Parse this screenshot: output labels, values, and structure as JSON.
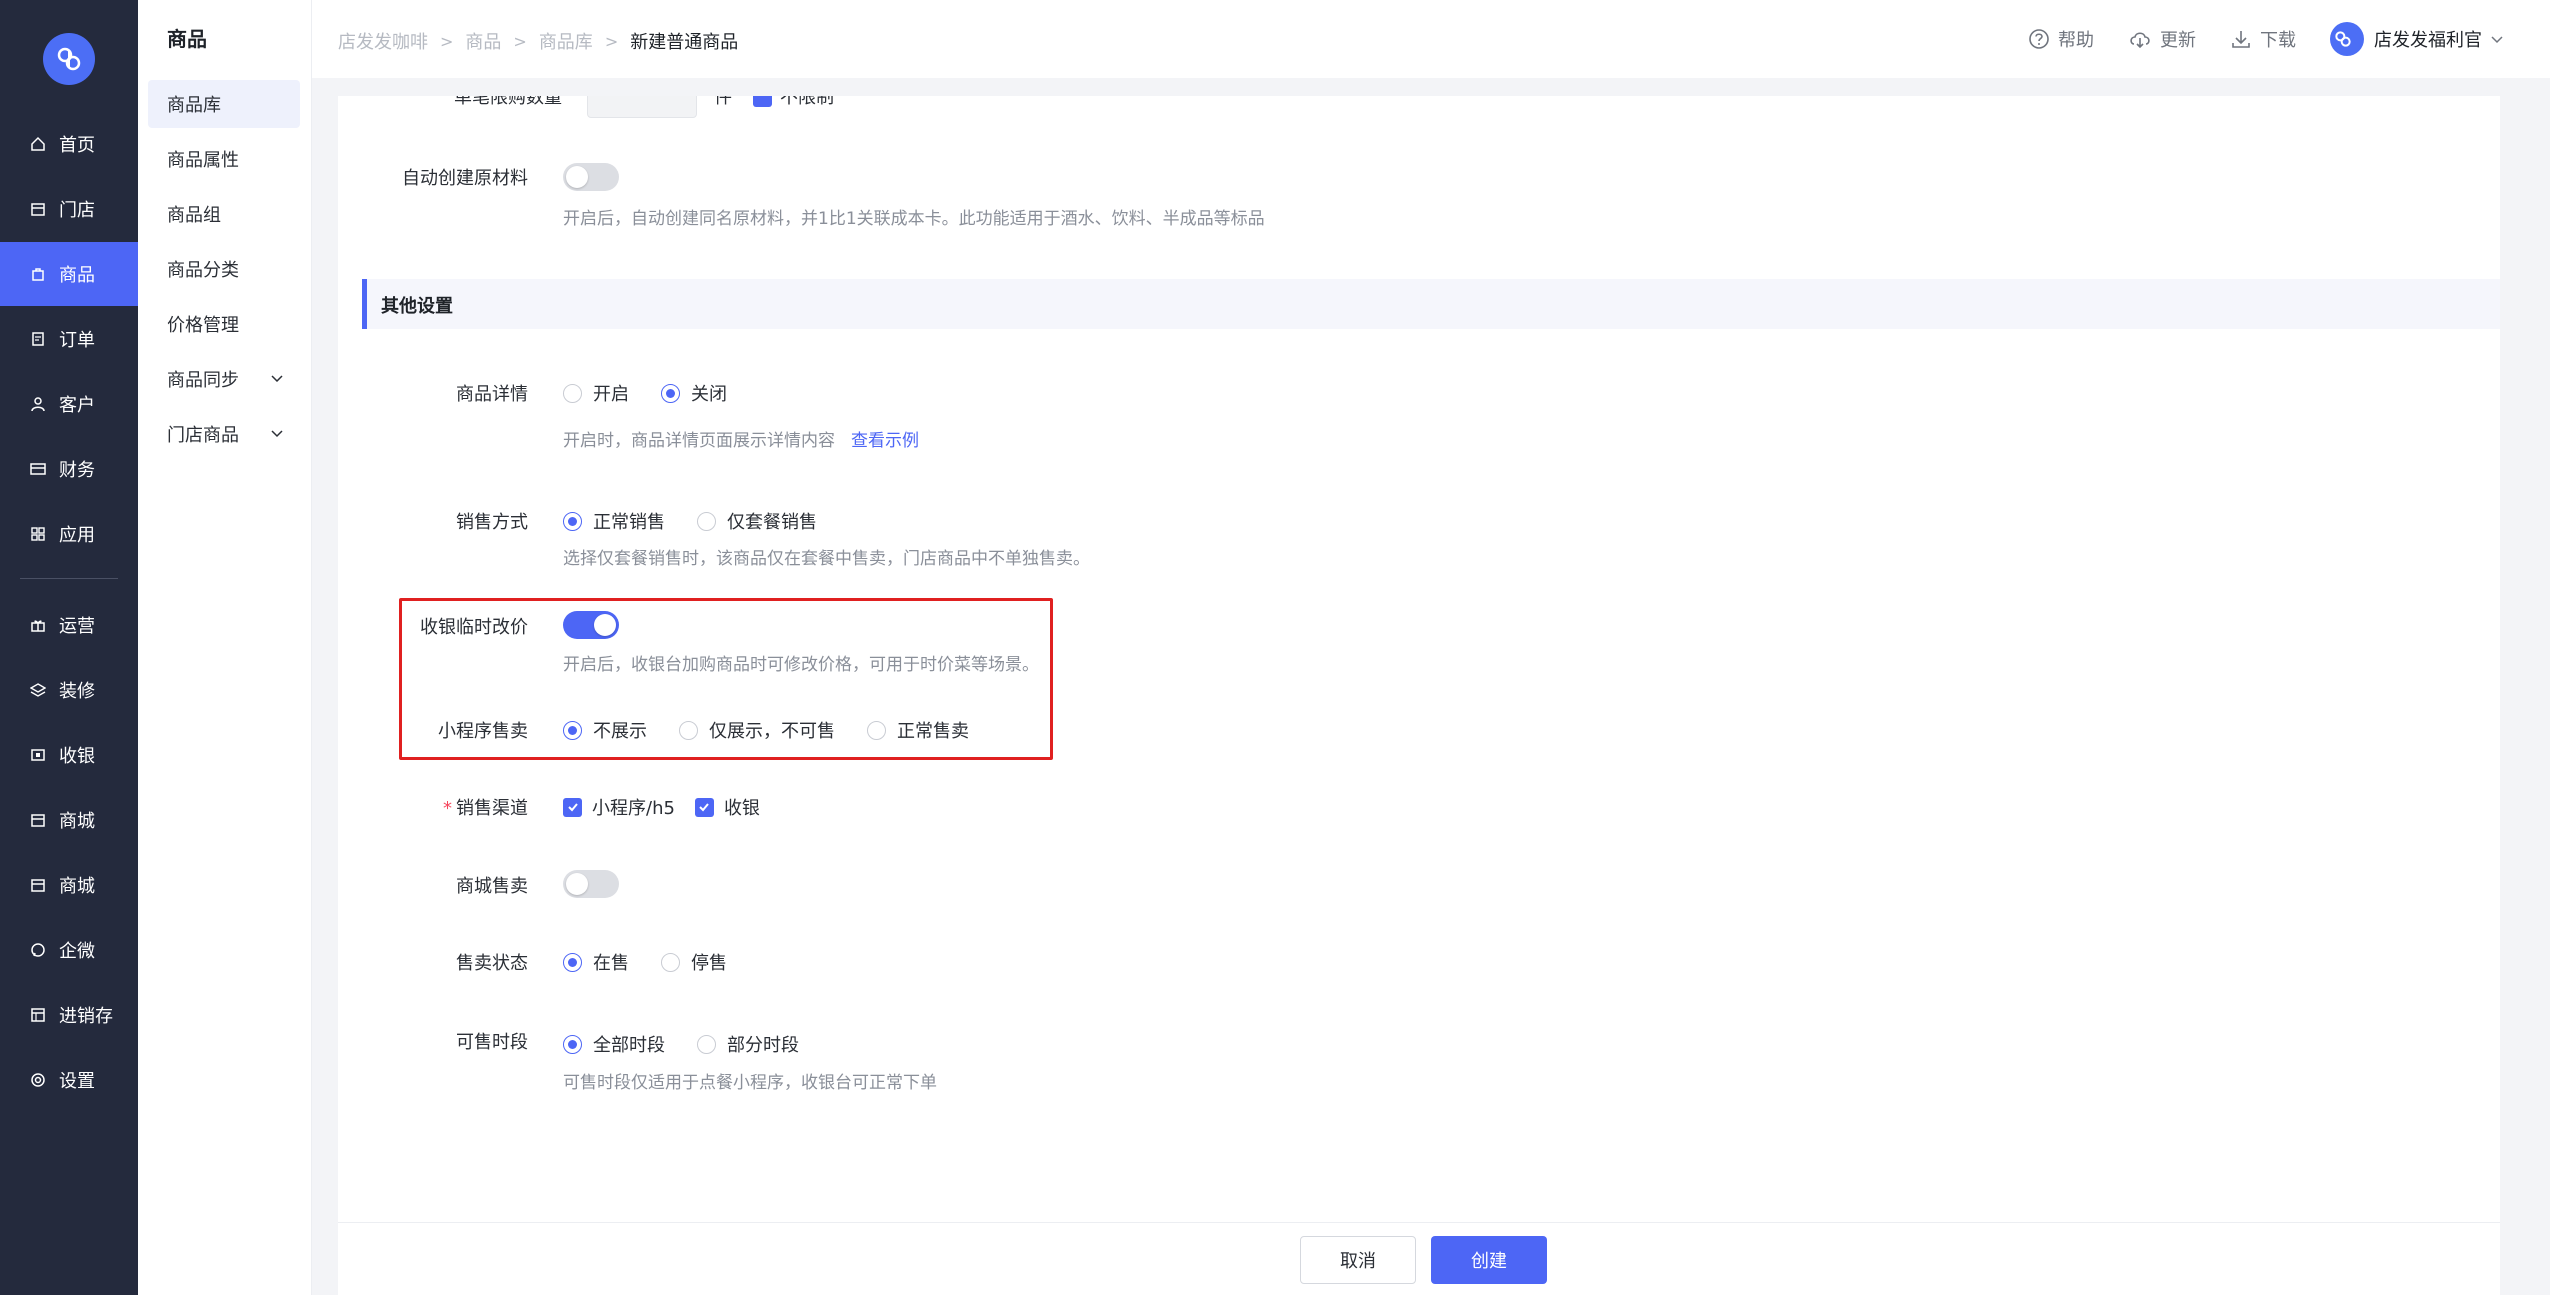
{
  "nav": {
    "items": [
      {
        "label": "首页",
        "icon": "home-icon"
      },
      {
        "label": "门店",
        "icon": "store-icon"
      },
      {
        "label": "商品",
        "icon": "bag-icon",
        "active": true
      },
      {
        "label": "订单",
        "icon": "order-icon"
      },
      {
        "label": "客户",
        "icon": "user-icon"
      },
      {
        "label": "财务",
        "icon": "card-icon"
      },
      {
        "label": "应用",
        "icon": "apps-icon"
      },
      {
        "label": "运营",
        "icon": "gift-icon"
      },
      {
        "label": "装修",
        "icon": "layers-icon"
      },
      {
        "label": "收银",
        "icon": "cashier-icon"
      },
      {
        "label": "商城",
        "icon": "mall-icon"
      },
      {
        "label": "商城",
        "icon": "mall-icon"
      },
      {
        "label": "企微",
        "icon": "chat-icon"
      },
      {
        "label": "进销存",
        "icon": "inventory-icon"
      },
      {
        "label": "设置",
        "icon": "settings-icon"
      }
    ]
  },
  "subnav": {
    "title": "商品",
    "items": [
      {
        "label": "商品库",
        "active": true
      },
      {
        "label": "商品属性"
      },
      {
        "label": "商品组"
      },
      {
        "label": "商品分类"
      },
      {
        "label": "价格管理"
      },
      {
        "label": "商品同步",
        "expandable": true
      },
      {
        "label": "门店商品",
        "expandable": true
      }
    ]
  },
  "header": {
    "breadcrumb": [
      "店发发咖啡",
      "商品",
      "商品库",
      "新建普通商品"
    ],
    "help": "帮助",
    "update": "更新",
    "download": "下载",
    "user": "店发发福利官"
  },
  "form": {
    "clipped_label": "单笔限购数量",
    "clipped_unit": "件",
    "clipped_check": "不限制",
    "auto_material": {
      "label": "自动创建原材料",
      "enabled": false,
      "hint": "开启后，自动创建同名原材料，并1比1关联成本卡。此功能适用于酒水、饮料、半成品等标品"
    },
    "section_title": "其他设置",
    "detail": {
      "label": "商品详情",
      "options": [
        "开启",
        "关闭"
      ],
      "selected": "关闭",
      "hint": "开启时，商品详情页面展示详情内容",
      "hint_link": "查看示例"
    },
    "sale_mode": {
      "label": "销售方式",
      "options": [
        "正常销售",
        "仅套餐销售"
      ],
      "selected": "正常销售",
      "hint": "选择仅套餐销售时，该商品仅在套餐中售卖，门店商品中不单独售卖。"
    },
    "temp_price": {
      "label": "收银临时改价",
      "enabled": true,
      "hint": "开启后，收银台加购商品时可修改价格，可用于时价菜等场景。"
    },
    "mini_program": {
      "label": "小程序售卖",
      "options": [
        "不展示",
        "仅展示，不可售",
        "正常售卖"
      ],
      "selected": "不展示"
    },
    "channels": {
      "required_mark": "*",
      "label": "销售渠道",
      "options": [
        "小程序/h5",
        "收银"
      ]
    },
    "mall_sale": {
      "label": "商城售卖",
      "enabled": false
    },
    "sale_status": {
      "label": "售卖状态",
      "options": [
        "在售",
        "停售"
      ],
      "selected": "在售"
    },
    "sale_time": {
      "label": "可售时段",
      "options": [
        "全部时段",
        "部分时段"
      ],
      "selected": "全部时段",
      "hint": "可售时段仅适用于点餐小程序，收银台可正常下单"
    }
  },
  "footer": {
    "cancel": "取消",
    "create": "创建"
  },
  "colors": {
    "primary": "#4d66f5",
    "nav_bg": "#242a3d",
    "highlight": "#e02020"
  }
}
